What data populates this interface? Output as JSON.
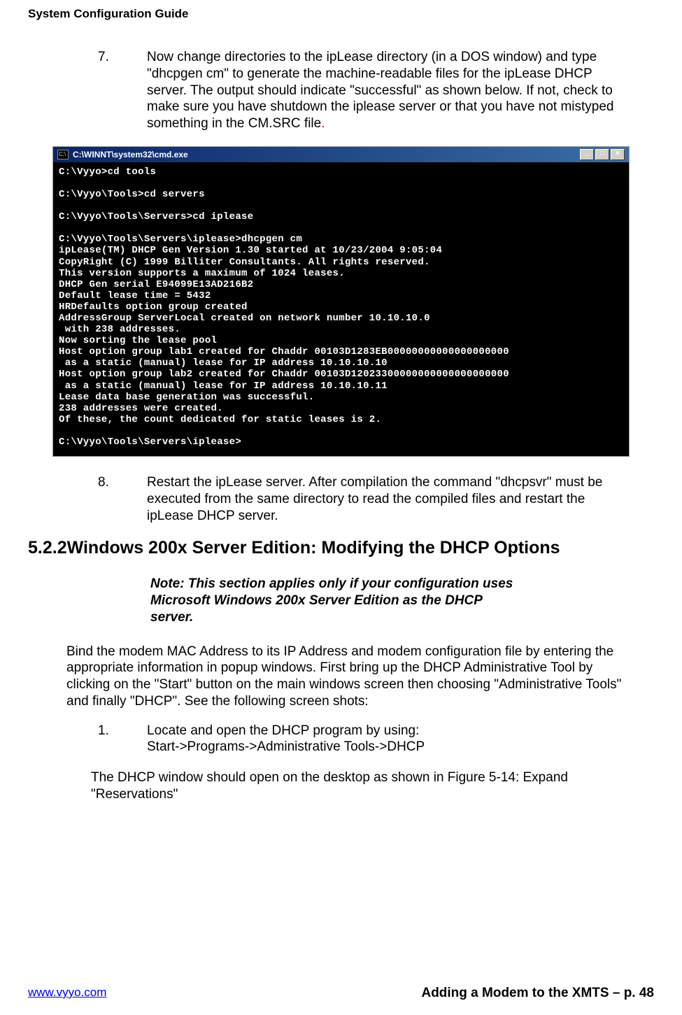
{
  "header": {
    "title": "System Configuration Guide"
  },
  "item7": {
    "num": "7.",
    "text": "Now change directories to the ipLease directory (in a DOS window) and type \"dhcpgen cm\" to generate the machine-readable files for the ipLease DHCP server.  The output should indicate \"successful\" as shown below.  If not, check to make sure you have shutdown the iplease server or that you have not mistyped something in the CM.SRC file",
    "dot": "."
  },
  "terminal": {
    "title": "C:\\WINNT\\system32\\cmd.exe",
    "min": "_",
    "max": "□",
    "close": "×",
    "lines": "C:\\Vyyo>cd tools\n\nC:\\Vyyo\\Tools>cd servers\n\nC:\\Vyyo\\Tools\\Servers>cd iplease\n\nC:\\Vyyo\\Tools\\Servers\\iplease>dhcpgen cm\nipLease(TM) DHCP Gen Version 1.30 started at 10/23/2004 9:05:04\nCopyRight (C) 1999 Billiter Consultants. All rights reserved.\nThis version supports a maximum of 1024 leases.\nDHCP Gen serial E94099E13AD216B2\nDefault lease time = 5432\nHRDefaults option group created\nAddressGroup ServerLocal created on network number 10.10.10.0\n with 238 addresses.\nNow sorting the lease pool\nHost option group lab1 created for Chaddr 00103D1283EB00000000000000000000\n as a static (manual) lease for IP address 10.10.10.10\nHost option group lab2 created for Chaddr 00103D12023300000000000000000000\n as a static (manual) lease for IP address 10.10.10.11\nLease data base generation was successful.\n238 addresses were created.\nOf these, the count dedicated for static leases is 2.\n\nC:\\Vyyo\\Tools\\Servers\\iplease>"
  },
  "item8": {
    "num": "8.",
    "text": "Restart the ipLease server.  After compilation the command \"dhcpsvr\" must be executed from the same directory to read the compiled files and restart the ipLease DHCP server."
  },
  "section": {
    "num": "5.2.2",
    "title": "Windows 200x Server Edition: Modifying the  DHCP Options"
  },
  "note": {
    "label": "Note",
    "text": ": This section applies only if your configuration uses Microsoft Windows 200x Server Edition as the DHCP server."
  },
  "para1": "Bind the modem MAC Address to its IP Address and modem configuration file by entering the appropriate information in popup windows.  First bring up the DHCP Administrative Tool by clicking on the \"Start\" button on the main windows screen then choosing \"Administrative Tools\" and finally \"DHCP\".  See the following screen shots:",
  "item1": {
    "num": "1.",
    "text1": "Locate and open the DHCP program by using:",
    "text2": "Start->Programs->Administrative Tools->DHCP"
  },
  "para2": "The DHCP window should open on the desktop as shown in Figure 5-14: Expand \"Reservations\"",
  "footer": {
    "left": "www.vyyo.com",
    "right": "Adding a Modem to the XMTS – p. 48"
  }
}
